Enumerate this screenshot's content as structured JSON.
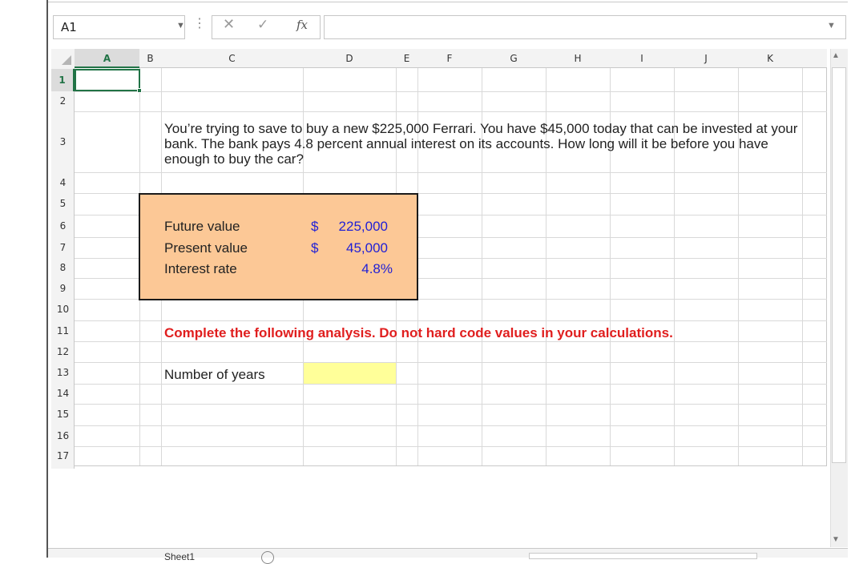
{
  "formula_bar": {
    "name_box": "A1",
    "cancel_icon": "✕",
    "enter_icon": "✓",
    "fx_label": "fx",
    "formula": ""
  },
  "columns": [
    "A",
    "B",
    "C",
    "D",
    "E",
    "F",
    "G",
    "H",
    "I",
    "J",
    "K"
  ],
  "rows": [
    "1",
    "2",
    "3",
    "4",
    "5",
    "6",
    "7",
    "8",
    "9",
    "10",
    "11",
    "12",
    "13",
    "14",
    "15",
    "16",
    "17"
  ],
  "active_cell": "A1",
  "question": "You’re trying to save to buy a new $225,000 Ferrari. You have $45,000 today that can be invested at your bank. The bank pays 4.8 percent annual interest on its accounts. How long will it be before you have enough to buy the car?",
  "inputs": [
    {
      "label": "Future value",
      "currency": "$",
      "value": "225,000"
    },
    {
      "label": "Present value",
      "currency": "$",
      "value": "45,000"
    },
    {
      "label": "Interest rate",
      "currency": "",
      "value": "4.8%"
    }
  ],
  "instruction": "Complete the following analysis. Do not hard code values in your calculations.",
  "output": {
    "label": "Number of years",
    "value": ""
  },
  "sheet_tab": "Sheet1",
  "colors": {
    "input_box_fill": "#fcc896",
    "input_value_text": "#1f1fd6",
    "instruction_text": "#e01e1e",
    "answer_cell_fill": "#ffff99",
    "active_cell_border": "#217346"
  }
}
